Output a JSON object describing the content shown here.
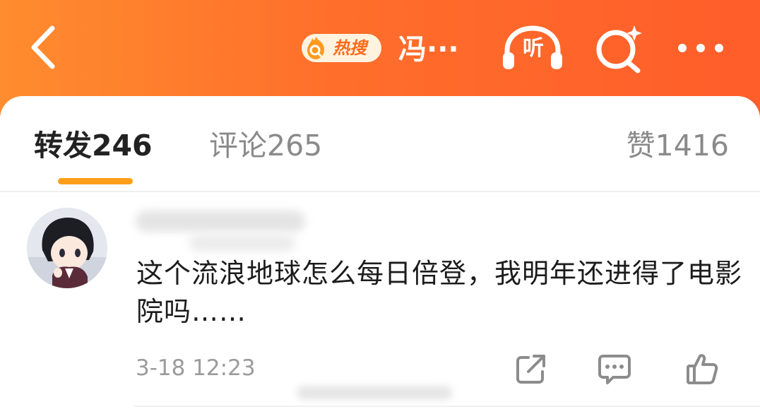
{
  "header": {
    "hot_search_label": "热搜",
    "title": "冯···",
    "listen_label": "听",
    "icons": {
      "back": "chevron-left-icon",
      "hot_search": "search-flame-icon",
      "listen": "headphones-icon",
      "search": "search-sparkle-icon",
      "more": "more-dots-icon"
    }
  },
  "tabs": [
    {
      "label": "转发",
      "count": "246"
    },
    {
      "label": "评论",
      "count": "265"
    },
    {
      "label": "赞",
      "count": "1416"
    }
  ],
  "comment": {
    "text": "这个流浪地球怎么每日倍登，我明年还进得了电影院吗……",
    "timestamp": "3-18 12:23",
    "actions": [
      "share-icon",
      "comment-icon",
      "like-icon"
    ]
  },
  "colors": {
    "header_gradient_start": "#ff8c2e",
    "header_gradient_end": "#ff5d2a",
    "active_tab_indicator": "#ff9f1a",
    "primary_text": "#222222",
    "secondary_text": "#8a8a8a"
  }
}
